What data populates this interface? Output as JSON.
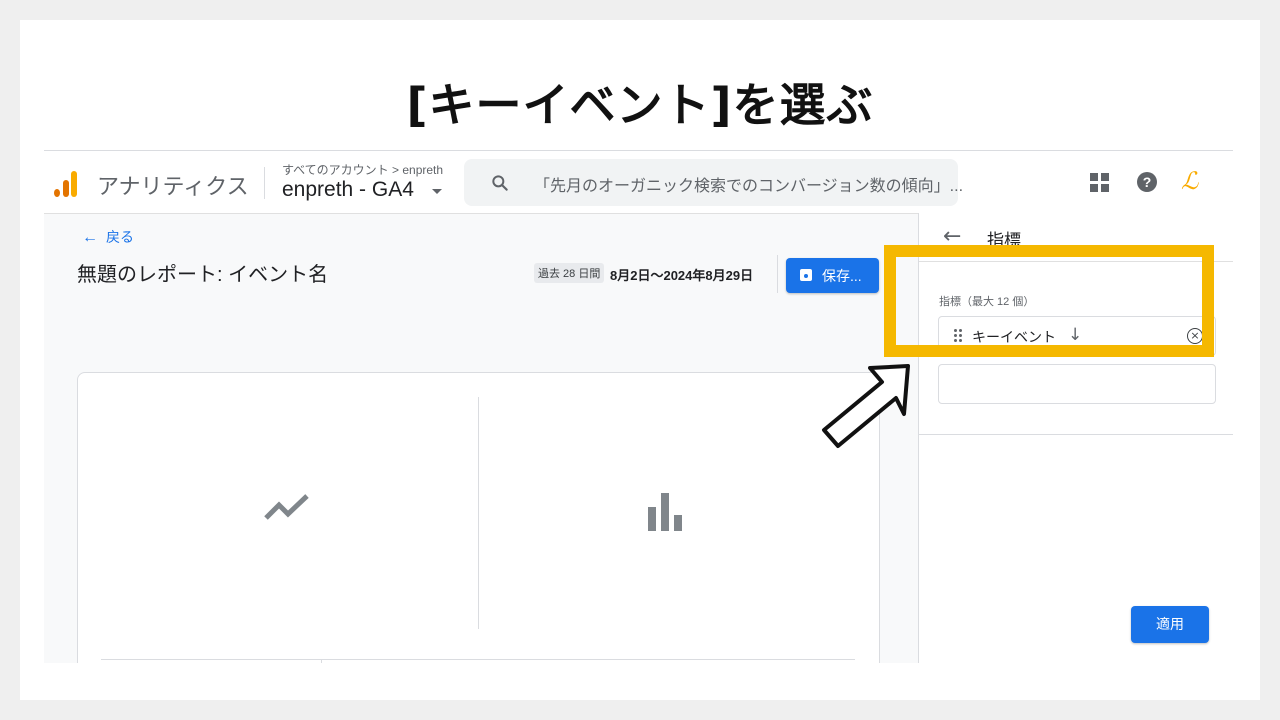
{
  "slide": {
    "title": "[キーイベント]を選ぶ"
  },
  "header": {
    "app_name": "アナリティクス",
    "breadcrumb": "すべてのアカウント > enpreth",
    "account": "enpreth - GA4",
    "search_placeholder": "「先月のオーガニック検索でのコンバージョン数の傾向」...",
    "icons": [
      "analytics-logo",
      "search-icon",
      "apps-grid-icon",
      "help-icon",
      "user-avatar-icon"
    ]
  },
  "report": {
    "back_label": "戻る",
    "title": "無題のレポート: イベント名",
    "date_chip": "過去 28 日間",
    "date_range": "8月2日～2024年8月29日",
    "save_label": "保存..."
  },
  "panel": {
    "title": "指標",
    "metrics_label": "指標（最大 12 個）",
    "metric_item": "キーイベント",
    "apply_label": "適用"
  },
  "colors": {
    "accent": "#1a73e8",
    "highlight": "#f5b800",
    "logo_orange": "#e37400",
    "logo_yellow": "#f9ab00"
  }
}
